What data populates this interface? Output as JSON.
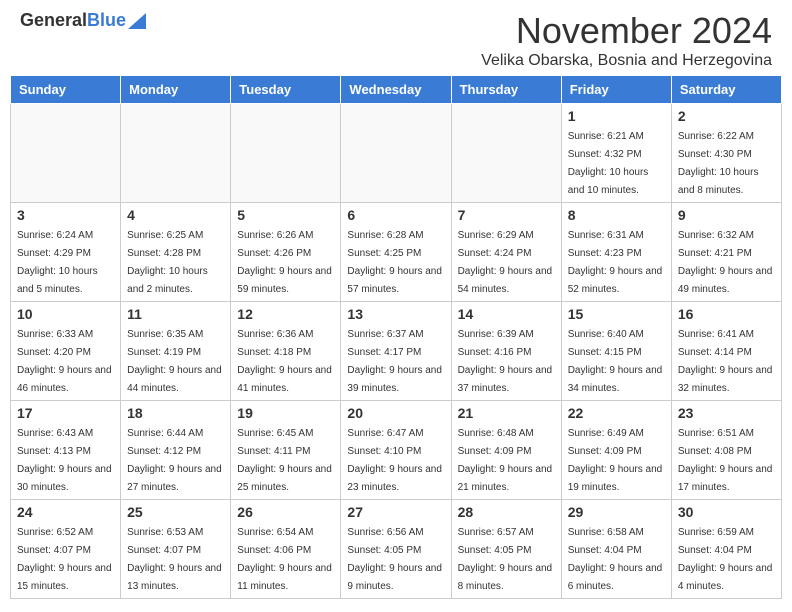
{
  "header": {
    "logo_general": "General",
    "logo_blue": "Blue",
    "month_title": "November 2024",
    "location": "Velika Obarska, Bosnia and Herzegovina"
  },
  "days_of_week": [
    "Sunday",
    "Monday",
    "Tuesday",
    "Wednesday",
    "Thursday",
    "Friday",
    "Saturday"
  ],
  "weeks": [
    [
      {
        "day": "",
        "info": "",
        "empty": true
      },
      {
        "day": "",
        "info": "",
        "empty": true
      },
      {
        "day": "",
        "info": "",
        "empty": true
      },
      {
        "day": "",
        "info": "",
        "empty": true
      },
      {
        "day": "",
        "info": "",
        "empty": true
      },
      {
        "day": "1",
        "info": "Sunrise: 6:21 AM\nSunset: 4:32 PM\nDaylight: 10 hours and 10 minutes.",
        "empty": false
      },
      {
        "day": "2",
        "info": "Sunrise: 6:22 AM\nSunset: 4:30 PM\nDaylight: 10 hours and 8 minutes.",
        "empty": false
      }
    ],
    [
      {
        "day": "3",
        "info": "Sunrise: 6:24 AM\nSunset: 4:29 PM\nDaylight: 10 hours and 5 minutes.",
        "empty": false
      },
      {
        "day": "4",
        "info": "Sunrise: 6:25 AM\nSunset: 4:28 PM\nDaylight: 10 hours and 2 minutes.",
        "empty": false
      },
      {
        "day": "5",
        "info": "Sunrise: 6:26 AM\nSunset: 4:26 PM\nDaylight: 9 hours and 59 minutes.",
        "empty": false
      },
      {
        "day": "6",
        "info": "Sunrise: 6:28 AM\nSunset: 4:25 PM\nDaylight: 9 hours and 57 minutes.",
        "empty": false
      },
      {
        "day": "7",
        "info": "Sunrise: 6:29 AM\nSunset: 4:24 PM\nDaylight: 9 hours and 54 minutes.",
        "empty": false
      },
      {
        "day": "8",
        "info": "Sunrise: 6:31 AM\nSunset: 4:23 PM\nDaylight: 9 hours and 52 minutes.",
        "empty": false
      },
      {
        "day": "9",
        "info": "Sunrise: 6:32 AM\nSunset: 4:21 PM\nDaylight: 9 hours and 49 minutes.",
        "empty": false
      }
    ],
    [
      {
        "day": "10",
        "info": "Sunrise: 6:33 AM\nSunset: 4:20 PM\nDaylight: 9 hours and 46 minutes.",
        "empty": false
      },
      {
        "day": "11",
        "info": "Sunrise: 6:35 AM\nSunset: 4:19 PM\nDaylight: 9 hours and 44 minutes.",
        "empty": false
      },
      {
        "day": "12",
        "info": "Sunrise: 6:36 AM\nSunset: 4:18 PM\nDaylight: 9 hours and 41 minutes.",
        "empty": false
      },
      {
        "day": "13",
        "info": "Sunrise: 6:37 AM\nSunset: 4:17 PM\nDaylight: 9 hours and 39 minutes.",
        "empty": false
      },
      {
        "day": "14",
        "info": "Sunrise: 6:39 AM\nSunset: 4:16 PM\nDaylight: 9 hours and 37 minutes.",
        "empty": false
      },
      {
        "day": "15",
        "info": "Sunrise: 6:40 AM\nSunset: 4:15 PM\nDaylight: 9 hours and 34 minutes.",
        "empty": false
      },
      {
        "day": "16",
        "info": "Sunrise: 6:41 AM\nSunset: 4:14 PM\nDaylight: 9 hours and 32 minutes.",
        "empty": false
      }
    ],
    [
      {
        "day": "17",
        "info": "Sunrise: 6:43 AM\nSunset: 4:13 PM\nDaylight: 9 hours and 30 minutes.",
        "empty": false
      },
      {
        "day": "18",
        "info": "Sunrise: 6:44 AM\nSunset: 4:12 PM\nDaylight: 9 hours and 27 minutes.",
        "empty": false
      },
      {
        "day": "19",
        "info": "Sunrise: 6:45 AM\nSunset: 4:11 PM\nDaylight: 9 hours and 25 minutes.",
        "empty": false
      },
      {
        "day": "20",
        "info": "Sunrise: 6:47 AM\nSunset: 4:10 PM\nDaylight: 9 hours and 23 minutes.",
        "empty": false
      },
      {
        "day": "21",
        "info": "Sunrise: 6:48 AM\nSunset: 4:09 PM\nDaylight: 9 hours and 21 minutes.",
        "empty": false
      },
      {
        "day": "22",
        "info": "Sunrise: 6:49 AM\nSunset: 4:09 PM\nDaylight: 9 hours and 19 minutes.",
        "empty": false
      },
      {
        "day": "23",
        "info": "Sunrise: 6:51 AM\nSunset: 4:08 PM\nDaylight: 9 hours and 17 minutes.",
        "empty": false
      }
    ],
    [
      {
        "day": "24",
        "info": "Sunrise: 6:52 AM\nSunset: 4:07 PM\nDaylight: 9 hours and 15 minutes.",
        "empty": false
      },
      {
        "day": "25",
        "info": "Sunrise: 6:53 AM\nSunset: 4:07 PM\nDaylight: 9 hours and 13 minutes.",
        "empty": false
      },
      {
        "day": "26",
        "info": "Sunrise: 6:54 AM\nSunset: 4:06 PM\nDaylight: 9 hours and 11 minutes.",
        "empty": false
      },
      {
        "day": "27",
        "info": "Sunrise: 6:56 AM\nSunset: 4:05 PM\nDaylight: 9 hours and 9 minutes.",
        "empty": false
      },
      {
        "day": "28",
        "info": "Sunrise: 6:57 AM\nSunset: 4:05 PM\nDaylight: 9 hours and 8 minutes.",
        "empty": false
      },
      {
        "day": "29",
        "info": "Sunrise: 6:58 AM\nSunset: 4:04 PM\nDaylight: 9 hours and 6 minutes.",
        "empty": false
      },
      {
        "day": "30",
        "info": "Sunrise: 6:59 AM\nSunset: 4:04 PM\nDaylight: 9 hours and 4 minutes.",
        "empty": false
      }
    ]
  ]
}
